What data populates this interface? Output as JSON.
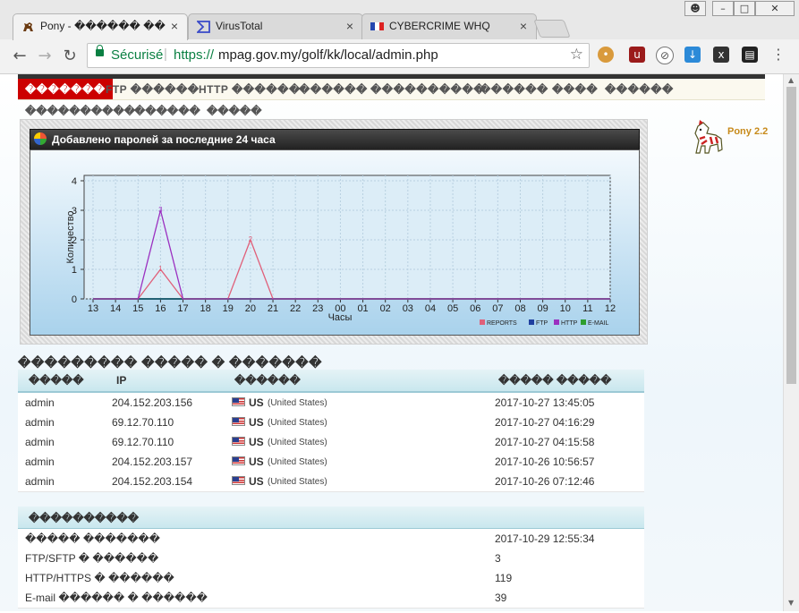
{
  "browser": {
    "tabs": [
      {
        "title": "Pony - ������ ��",
        "active": true
      },
      {
        "title": "VirusTotal",
        "active": false
      },
      {
        "title": "CYBERCRIME WHQ",
        "active": false
      }
    ],
    "secure_label": "Sécurisé",
    "url_proto": "https://",
    "url_rest": "mpag.gov.my/golf/kk/local/admin.php",
    "close_glyph": "×"
  },
  "menu": {
    "items": [
      "�������",
      "FTP ������",
      "HTTP ������",
      "������",
      "����������",
      "������",
      "����",
      "������"
    ],
    "subitems": [
      "����������",
      "������",
      "�����"
    ]
  },
  "pony_version": "Pony 2.2",
  "chart_data": {
    "type": "line",
    "title": "Добавлено паролей за последние 24 часа",
    "xlabel": "Часы",
    "ylabel": "Количество",
    "categories": [
      "13",
      "14",
      "15",
      "16",
      "17",
      "18",
      "19",
      "20",
      "21",
      "22",
      "23",
      "00",
      "01",
      "02",
      "03",
      "04",
      "05",
      "06",
      "07",
      "08",
      "09",
      "10",
      "11",
      "12"
    ],
    "ylim": [
      0,
      4
    ],
    "yticks": [
      0,
      1,
      2,
      3,
      4
    ],
    "grid": true,
    "legend_position": "bottom-right",
    "series": [
      {
        "name": "REPORTS",
        "color": "#e0607a",
        "values": [
          0,
          0,
          0,
          1,
          0,
          0,
          0,
          2,
          0,
          0,
          0,
          0,
          0,
          0,
          0,
          0,
          0,
          0,
          0,
          0,
          0,
          0,
          0,
          0
        ]
      },
      {
        "name": "FTP",
        "color": "#1f3f9f",
        "values": [
          0,
          0,
          0,
          0,
          0,
          0,
          0,
          0,
          0,
          0,
          0,
          0,
          0,
          0,
          0,
          0,
          0,
          0,
          0,
          0,
          0,
          0,
          0,
          0
        ]
      },
      {
        "name": "HTTP",
        "color": "#9b30c0",
        "values": [
          0,
          0,
          0,
          3,
          0,
          0,
          0,
          0,
          0,
          0,
          0,
          0,
          0,
          0,
          0,
          0,
          0,
          0,
          0,
          0,
          0,
          0,
          0,
          0
        ]
      },
      {
        "name": "E-MAIL",
        "color": "#2e9e2e",
        "values": [
          0,
          0,
          0,
          0,
          0,
          0,
          0,
          0,
          0,
          0,
          0,
          0,
          0,
          0,
          0,
          0,
          0,
          0,
          0,
          0,
          0,
          0,
          0,
          0
        ]
      }
    ]
  },
  "logins": {
    "title": "��������� ����� � �������",
    "headers": [
      "�����",
      "IP",
      "������",
      "����� �����"
    ],
    "rows": [
      {
        "user": "admin",
        "ip": "204.152.203.156",
        "cc": "US",
        "country": "(United States)",
        "time": "2017-10-27 13:45:05"
      },
      {
        "user": "admin",
        "ip": "69.12.70.110",
        "cc": "US",
        "country": "(United States)",
        "time": "2017-10-27 04:16:29"
      },
      {
        "user": "admin",
        "ip": "69.12.70.110",
        "cc": "US",
        "country": "(United States)",
        "time": "2017-10-27 04:15:58"
      },
      {
        "user": "admin",
        "ip": "204.152.203.157",
        "cc": "US",
        "country": "(United States)",
        "time": "2017-10-26 10:56:57"
      },
      {
        "user": "admin",
        "ip": "204.152.203.154",
        "cc": "US",
        "country": "(United States)",
        "time": "2017-10-26 07:12:46"
      }
    ]
  },
  "stats": {
    "title": "����������",
    "rows": [
      {
        "label": "����� �������",
        "value": "2017-10-29 12:55:34"
      },
      {
        "label": "FTP/SFTP � ������",
        "value": "3"
      },
      {
        "label": "HTTP/HTTPS � ������",
        "value": "119"
      },
      {
        "label": "E-mail ������ � ������",
        "value": "39"
      }
    ]
  }
}
